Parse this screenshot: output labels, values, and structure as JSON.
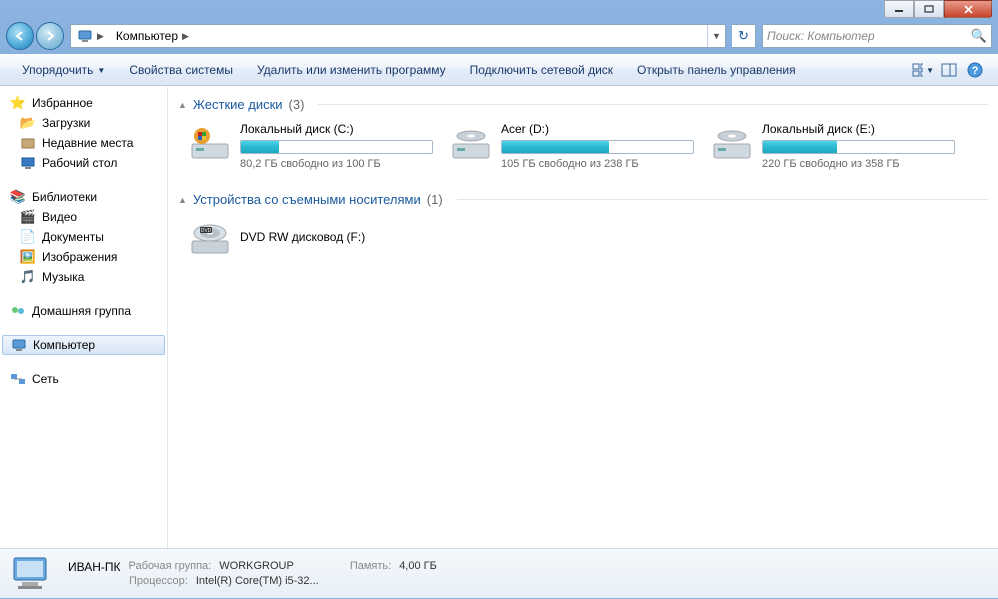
{
  "breadcrumb": {
    "location": "Компьютер"
  },
  "search": {
    "placeholder": "Поиск: Компьютер"
  },
  "toolbar": {
    "organize": "Упорядочить",
    "properties": "Свойства системы",
    "uninstall": "Удалить или изменить программу",
    "map_drive": "Подключить сетевой диск",
    "control_panel": "Открыть панель управления"
  },
  "sidebar": {
    "favorites": {
      "title": "Избранное",
      "items": [
        "Загрузки",
        "Недавние места",
        "Рабочий стол"
      ]
    },
    "libraries": {
      "title": "Библиотеки",
      "items": [
        "Видео",
        "Документы",
        "Изображения",
        "Музыка"
      ]
    },
    "homegroup": "Домашняя группа",
    "computer": "Компьютер",
    "network": "Сеть"
  },
  "sections": {
    "hard_drives": {
      "title": "Жесткие диски",
      "count": "(3)"
    },
    "removable": {
      "title": "Устройства со съемными носителями",
      "count": "(1)"
    }
  },
  "drives": [
    {
      "name": "Локальный диск (C:)",
      "free_text": "80,2 ГБ свободно из 100 ГБ",
      "fill_pct": 20,
      "system": true
    },
    {
      "name": "Acer (D:)",
      "free_text": "105 ГБ свободно из 238 ГБ",
      "fill_pct": 56,
      "system": false
    },
    {
      "name": "Локальный диск (E:)",
      "free_text": "220 ГБ свободно из 358 ГБ",
      "fill_pct": 39,
      "system": false
    }
  ],
  "removable_drives": [
    {
      "name": "DVD RW дисковод (F:)"
    }
  ],
  "status": {
    "name": "ИВАН-ПК",
    "workgroup_label": "Рабочая группа:",
    "workgroup": "WORKGROUP",
    "memory_label": "Память:",
    "memory": "4,00 ГБ",
    "processor_label": "Процессор:",
    "processor": "Intel(R) Core(TM) i5-32..."
  }
}
